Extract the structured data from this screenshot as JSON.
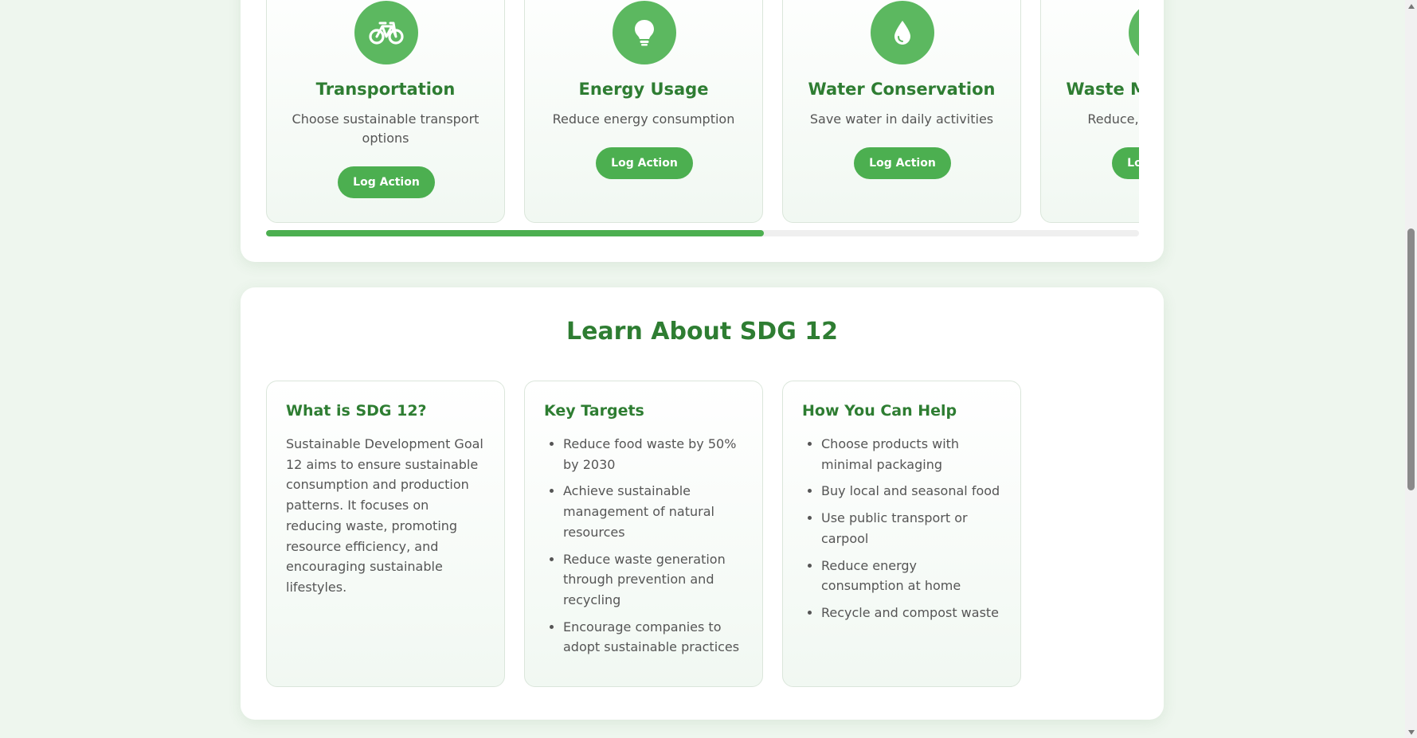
{
  "actions": [
    {
      "icon": "bicycle-icon",
      "title": "Transportation",
      "description": "Choose sustainable transport options",
      "button": "Log Action"
    },
    {
      "icon": "lightbulb-icon",
      "title": "Energy Usage",
      "description": "Reduce energy consumption",
      "button": "Log Action"
    },
    {
      "icon": "water-drop-icon",
      "title": "Water Conservation",
      "description": "Save water in daily activities",
      "button": "Log Action"
    },
    {
      "icon": "recycle-icon",
      "title": "Waste Management",
      "description": "Reduce, reuse, recycle",
      "button": "Log Action"
    }
  ],
  "carousel_progress": 0.57,
  "learn": {
    "title": "Learn About SDG 12",
    "cards": [
      {
        "title": "What is SDG 12?",
        "text": "Sustainable Development Goal 12 aims to ensure sustainable consumption and production patterns. It focuses on reducing waste, promoting resource efficiency, and encouraging sustainable lifestyles."
      },
      {
        "title": "Key Targets",
        "items": [
          "Reduce food waste by 50% by 2030",
          "Achieve sustainable management of natural resources",
          "Reduce waste generation through prevention and recycling",
          "Encourage companies to adopt sustainable practices"
        ]
      },
      {
        "title": "How You Can Help",
        "items": [
          "Choose products with minimal packaging",
          "Buy local and seasonal food",
          "Use public transport or carpool",
          "Reduce energy consumption at home",
          "Recycle and compost waste"
        ]
      }
    ]
  },
  "colors": {
    "accent": "#4caf50",
    "heading": "#2e7d32",
    "background": "#eef6ee"
  }
}
